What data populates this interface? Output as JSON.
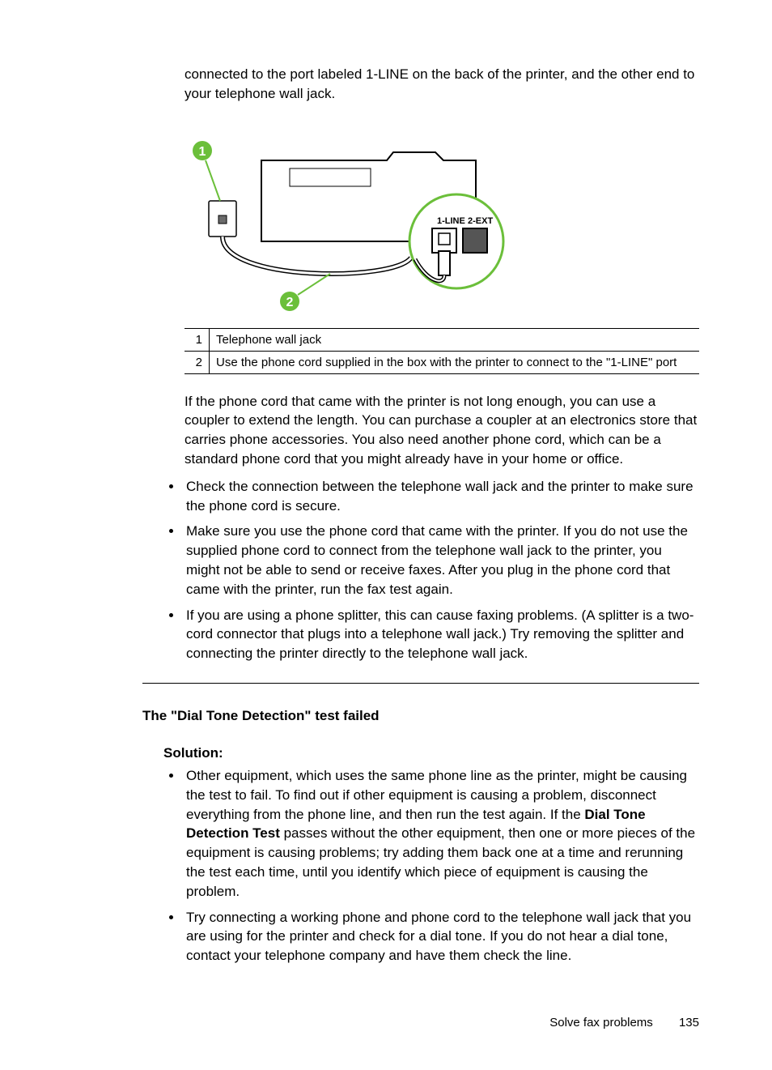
{
  "intro_para": "connected to the port labeled 1-LINE on the back of the printer, and the other end to your telephone wall jack.",
  "diagram": {
    "callout1": "1",
    "callout2": "2",
    "port1_label": "1-LINE",
    "port2_label": "2-EXT"
  },
  "legend": [
    {
      "n": "1",
      "text": "Telephone wall jack"
    },
    {
      "n": "2",
      "text": "Use the phone cord supplied in the box with the printer to connect to the \"1-LINE\" port"
    }
  ],
  "para_after_table": "If the phone cord that came with the printer is not long enough, you can use a coupler to extend the length. You can purchase a coupler at an electronics store that carries phone accessories. You also need another phone cord, which can be a standard phone cord that you might already have in your home or office.",
  "bullets1": [
    "Check the connection between the telephone wall jack and the printer to make sure the phone cord is secure.",
    "Make sure you use the phone cord that came with the printer. If you do not use the supplied phone cord to connect from the telephone wall jack to the printer, you might not be able to send or receive faxes. After you plug in the phone cord that came with the printer, run the fax test again.",
    "If you are using a phone splitter, this can cause faxing problems. (A splitter is a two-cord connector that plugs into a telephone wall jack.) Try removing the splitter and connecting the printer directly to the telephone wall jack."
  ],
  "heading2": "The \"Dial Tone Detection\" test failed",
  "solution_label": "Solution:",
  "bullets2_head": "Other equipment, which uses the same phone line as the printer, might be causing the test to fail. To find out if other equipment is causing a problem, disconnect everything from the phone line, and then run the test again. If the ",
  "bullets2_bold": "Dial Tone Detection Test",
  "bullets2_tail": " passes without the other equipment, then one or more pieces of the equipment is causing problems; try adding them back one at a time and rerunning the test each time, until you identify which piece of equipment is causing the problem.",
  "bullets2_item2": "Try connecting a working phone and phone cord to the telephone wall jack that you are using for the printer and check for a dial tone. If you do not hear a dial tone, contact your telephone company and have them check the line.",
  "footer": {
    "section": "Solve fax problems",
    "page": "135"
  }
}
